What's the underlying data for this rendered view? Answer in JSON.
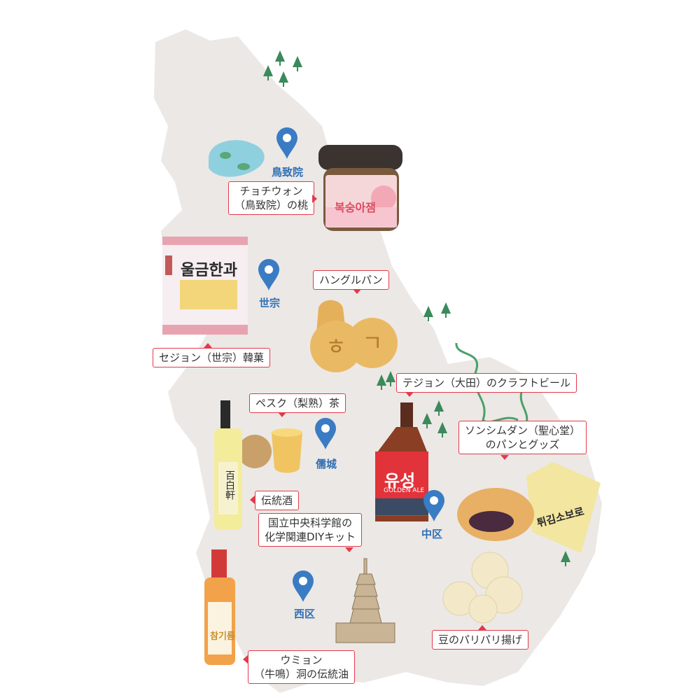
{
  "map": {
    "land_color": "#ece8e5",
    "pin_color": "#3a7cc4",
    "callout_border": "#e23a4a",
    "tree_color": "#3a8a5c"
  },
  "pins": [
    {
      "id": "pin-chochiwon",
      "label": "鳥致院"
    },
    {
      "id": "pin-sejong",
      "label": "世宗"
    },
    {
      "id": "pin-yuseong",
      "label": "儒城"
    },
    {
      "id": "pin-jung",
      "label": "中区"
    },
    {
      "id": "pin-seo",
      "label": "西区"
    }
  ],
  "callouts": {
    "peach": [
      "チョチウォン",
      "（鳥致院）の桃"
    ],
    "hanglbread": [
      "ハングルパン"
    ],
    "hangwa": [
      "セジョン（世宗）韓菓"
    ],
    "craftbeer": [
      "テジョン（大田）のクラフトビール"
    ],
    "sungsimdang": [
      "ソンシムダン（聖心堂）",
      "のパンとグッズ"
    ],
    "pear_tea": [
      "ペスク（梨熟）茶"
    ],
    "liquor": [
      "伝統酒"
    ],
    "diykit": [
      "国立中央科学館の",
      "化学関連DIYキット"
    ],
    "bean": [
      "豆のパリパリ揚げ"
    ],
    "oil": [
      "ウミョン",
      "（牛鳴）洞の伝統油"
    ]
  },
  "product_text": {
    "jam_label": "복숭아잼",
    "hangwa_label": "울금한과",
    "beer_label": "유성",
    "beer_sub": "GOLDEN ALE",
    "bread_bag_label": "튀김소보로",
    "oil_label": "참기름",
    "liquor_label": "百白軒"
  }
}
